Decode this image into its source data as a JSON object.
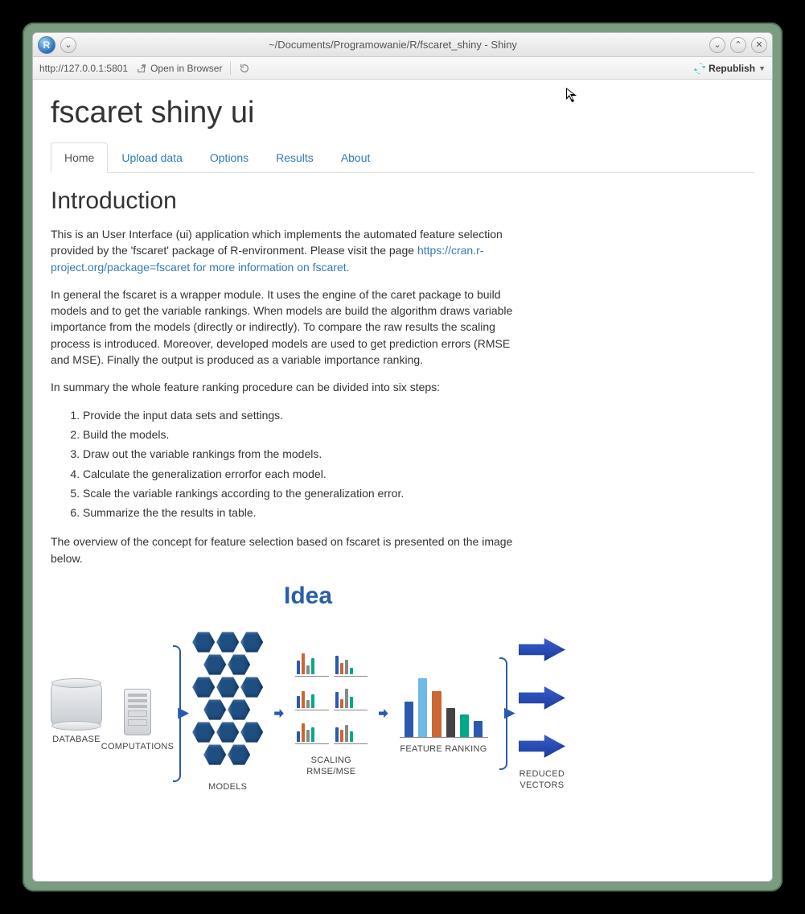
{
  "window": {
    "title": "~/Documents/Programowanie/R/fscaret_shiny - Shiny"
  },
  "toolbar": {
    "url": "http://127.0.0.1:5801",
    "open_in_browser": "Open in Browser",
    "republish": "Republish"
  },
  "app": {
    "title": "fscaret shiny ui",
    "tabs": [
      "Home",
      "Upload data",
      "Options",
      "Results",
      "About"
    ],
    "active_tab": 0
  },
  "intro": {
    "heading": "Introduction",
    "p1a": "This is an User Interface (ui) application which implements the automated feature selection provided by the 'fscaret' package of R-environment. Please visit the page ",
    "p1_link": "https://cran.r-project.org/package=fscaret for more information on fscaret.",
    "p2": "In general the fscaret is a wrapper module. It uses the engine of the caret package to build models and to get the variable rankings. When models are build the algorithm draws variable importance from the models (directly or indirectly). To compare the raw results the scaling process is introduced. Moreover, developed models are used to get prediction errors (RMSE and MSE). Finally the output is produced as a variable importance ranking.",
    "p3": "In summary the whole feature ranking procedure can be divided into six steps:",
    "steps": [
      "Provide the input data sets and settings.",
      "Build the models.",
      "Draw out the variable rankings from the models.",
      "Calculate the generalization errorfor each model.",
      "Scale the variable rankings according to the generalization error.",
      "Summarize the the results in table."
    ],
    "p4": "The overview of the concept for feature selection based on fscaret is presented on the image below."
  },
  "diagram": {
    "title": "Idea",
    "labels": {
      "database": "DATABASE",
      "computations": "COMPUTATIONS",
      "models": "MODELS",
      "scaling": "SCALING RMSE/MSE",
      "feature_ranking": "FEATURE RANKING",
      "reduced_vectors": "REDUCED VECTORS"
    }
  }
}
